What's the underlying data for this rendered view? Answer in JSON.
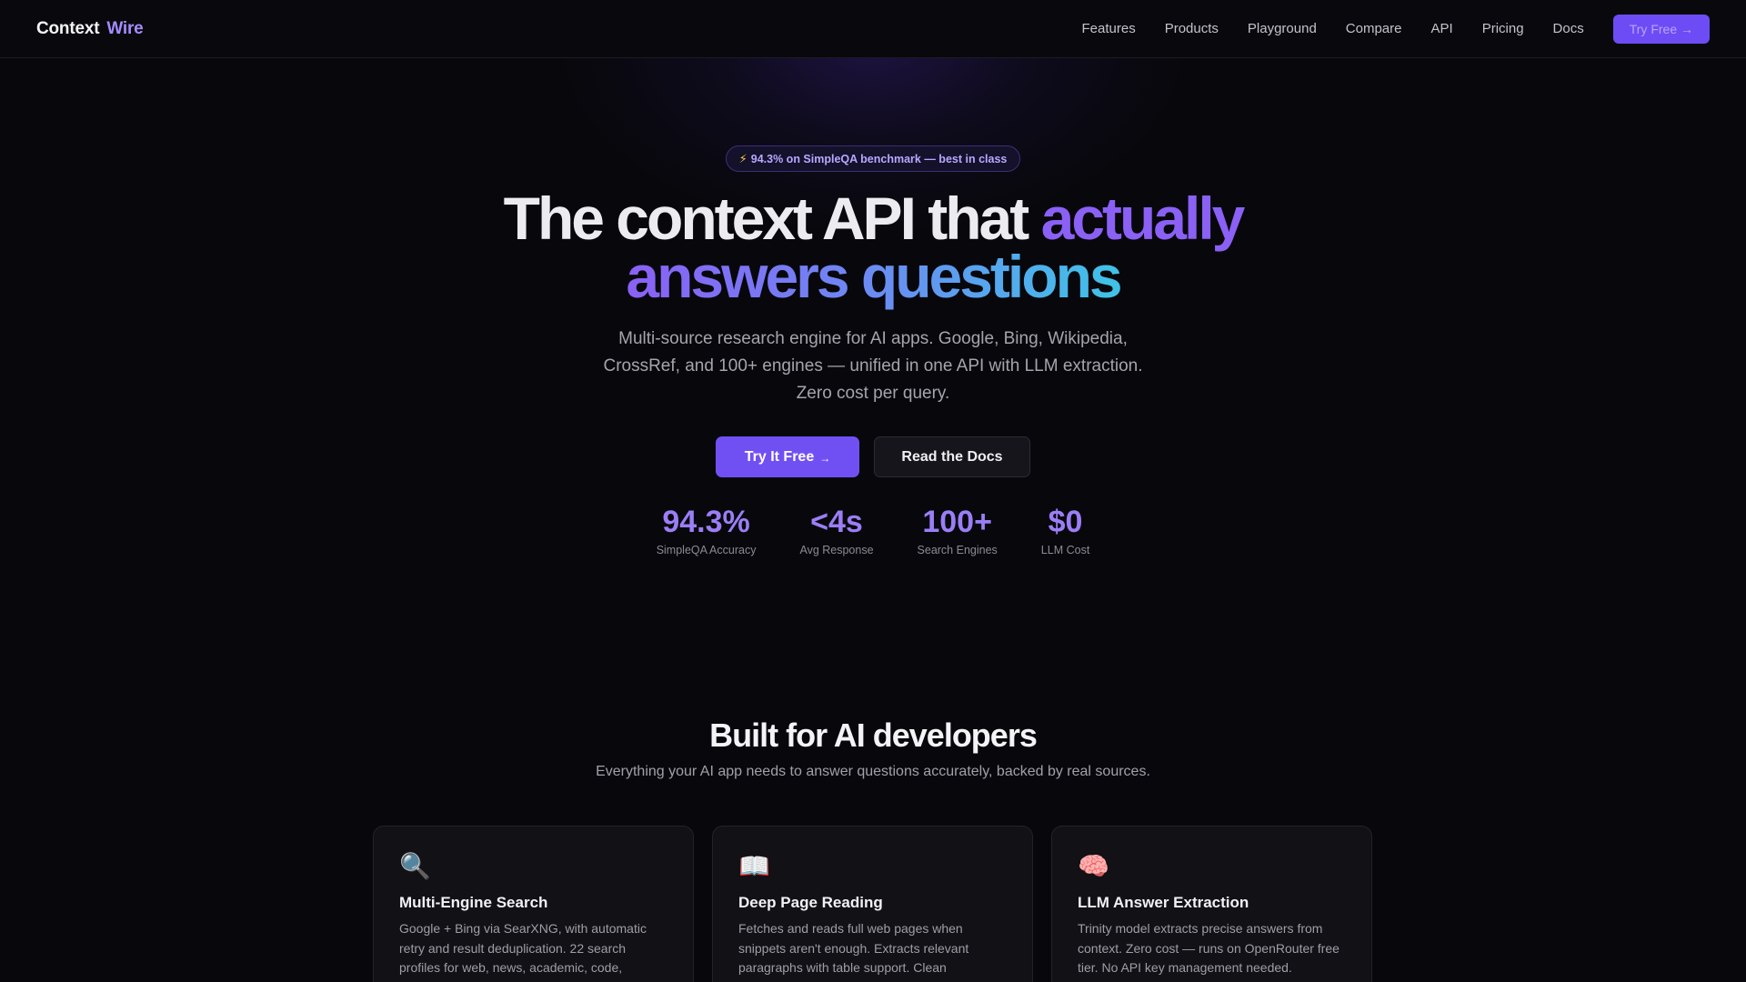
{
  "nav": {
    "logo_part1": "Context",
    "logo_part2": "Wire",
    "links": [
      "Features",
      "Products",
      "Playground",
      "Compare",
      "API",
      "Pricing",
      "Docs"
    ],
    "cta": "Try Free →"
  },
  "hero": {
    "badge": "94.3% on SimpleQA benchmark — best in class",
    "title_part1": "The context API that",
    "title_part2": "actually",
    "title_part3": "answers questions",
    "subtitle": "Multi-source research engine for AI apps. Google, Bing, Wikipedia, CrossRef, and 100+ engines — unified in one API with LLM extraction. Zero cost per query.",
    "primary_button": "Try It Free",
    "primary_arrow": "→",
    "secondary_button": "Read the Docs"
  },
  "stats": [
    {
      "value": "94.3%",
      "label": "SimpleQA Accuracy"
    },
    {
      "value": "<4s",
      "label": "Avg Response"
    },
    {
      "value": "100+",
      "label": "Search Engines"
    },
    {
      "value": "$0",
      "label": "LLM Cost"
    }
  ],
  "features_section": {
    "title": "Built for AI developers",
    "subtitle": "Everything your AI app needs to answer questions accurately, backed by real sources.",
    "cards": [
      {
        "icon": "🔍",
        "icon_name": "magnifier-icon",
        "title": "Multi-Engine Search",
        "description": "Google + Bing via SearXNG, with automatic retry and result deduplication. 22 search profiles for web, news, academic, code,"
      },
      {
        "icon": "📖",
        "icon_name": "book-icon",
        "title": "Deep Page Reading",
        "description": "Fetches and reads full web pages when snippets aren't enough. Extracts relevant paragraphs with table support. Clean"
      },
      {
        "icon": "🧠",
        "icon_name": "brain-icon",
        "title": "LLM Answer Extraction",
        "description": "Trinity model extracts precise answers from context. Zero cost — runs on OpenRouter free tier. No API key management needed."
      }
    ]
  },
  "colors": {
    "background": "#08080c",
    "accent": "#7150f3",
    "accent_text": "#9b7ef6",
    "gradient_end": "#3fc3e8"
  }
}
